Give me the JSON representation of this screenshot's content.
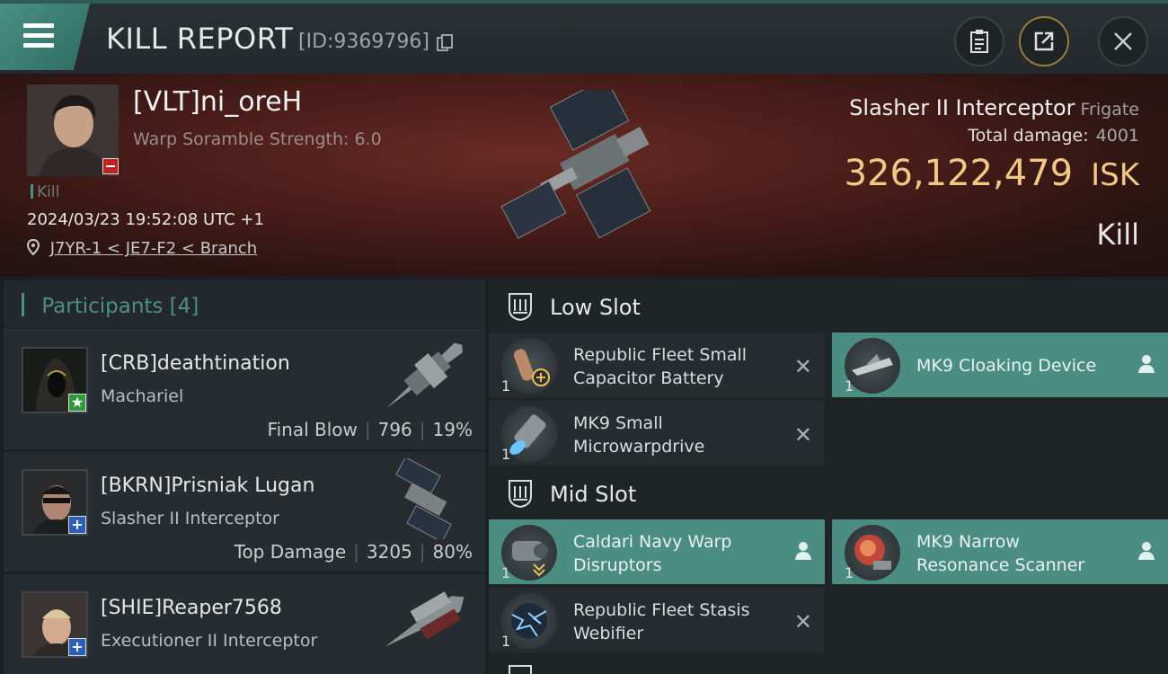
{
  "header": {
    "title": "KILL REPORT",
    "report_id": "[ID:9369796]"
  },
  "victim": {
    "name": "[VLT]ni_oreH",
    "scramble": "Warp Soramble Strength: 6.0",
    "kill_tag": "Kill",
    "datetime": "2024/03/23 19:52:08 UTC +1",
    "location": "J7YR-1 < JE7-F2 < Branch",
    "ship_name": "Slasher II Interceptor",
    "ship_class": "Frigate",
    "total_damage_label": "Total damage:",
    "total_damage": "4001",
    "isk_value": "326,122,479",
    "isk_unit": "ISK",
    "result": "Kill"
  },
  "participants": {
    "title": "Participants",
    "count": "[4]",
    "rows": [
      {
        "name": "[CRB]deathtination",
        "ship": "Machariel",
        "label": "Final Blow",
        "damage": "796",
        "percent": "19%",
        "badge": "★"
      },
      {
        "name": "[BKRN]Prisniak Lugan",
        "ship": "Slasher II Interceptor",
        "label": "Top Damage",
        "damage": "3205",
        "percent": "80%",
        "badge": "+"
      },
      {
        "name": "[SHIE]Reaper7568",
        "ship": "Executioner II Interceptor",
        "label": "",
        "damage": "",
        "percent": "",
        "badge": "+"
      }
    ]
  },
  "slots": {
    "low": {
      "title": "Low Slot",
      "modules": [
        {
          "name": "Republic Fleet Small Capacitor Battery",
          "qty": "1"
        },
        {
          "name": "MK9 Cloaking Device",
          "qty": "1"
        },
        {
          "name": "MK9 Small Microwarpdrive",
          "qty": "1"
        }
      ]
    },
    "mid": {
      "title": "Mid Slot",
      "modules": [
        {
          "name": "Caldari Navy Warp Disruptors",
          "qty": "1"
        },
        {
          "name": "MK9 Narrow Resonance Scanner",
          "qty": "1"
        },
        {
          "name": "Republic Fleet Stasis Webifier",
          "qty": "1"
        }
      ]
    }
  },
  "colors": {
    "accent": "#4d8f87",
    "isk": "#f3c886",
    "fitted": "#4b8d82"
  }
}
